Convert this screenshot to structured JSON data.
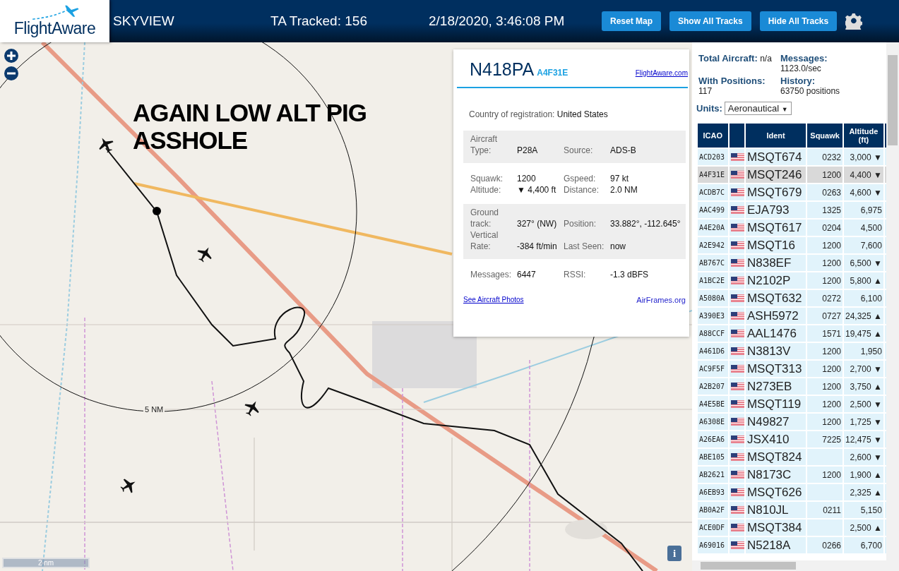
{
  "header": {
    "logo": "FlightAware",
    "title": "SKYVIEW",
    "tracked": "TA Tracked: 156",
    "datetime": "2/18/2020, 3:46:08 PM",
    "buttons": [
      "Reset Map",
      "Show All Tracks",
      "Hide All Tracks"
    ]
  },
  "map": {
    "annotation": "AGAIN LOW ALT PIG ASSHOLE",
    "ring_label": "5 NM",
    "scale": "2 nm",
    "info_button": "i"
  },
  "popup": {
    "ident": "N418PA",
    "hex": "A4F31E",
    "link": "FlightAware.com",
    "country_label": "Country of registration:",
    "country": "United States",
    "sections": [
      {
        "shaded": true,
        "rows": [
          [
            {
              "label": "Aircraft Type:",
              "value": "P28A"
            },
            {
              "label": "Source:",
              "value": "ADS-B"
            }
          ]
        ]
      },
      {
        "shaded": false,
        "rows": [
          [
            {
              "label": "Squawk:",
              "value": "1200"
            },
            {
              "label": "Gspeed:",
              "value": "97 kt"
            }
          ],
          [
            {
              "label": "Altitude:",
              "value": "▼ 4,400 ft"
            },
            {
              "label": "Distance:",
              "value": "2.0 NM"
            }
          ]
        ]
      },
      {
        "shaded": true,
        "rows": [
          [
            {
              "label": "Ground track:",
              "value": "327° (NW)"
            },
            {
              "label": "Position:",
              "value": "33.882°, -112.645°"
            }
          ],
          [
            {
              "label": "Vertical Rate:",
              "value": "-384 ft/min"
            },
            {
              "label": "Last Seen:",
              "value": "now"
            }
          ]
        ]
      },
      {
        "shaded": false,
        "rows": [
          [
            {
              "label": "Messages:",
              "value": "6447"
            },
            {
              "label": "RSSI:",
              "value": "-1.3 dBFS"
            }
          ]
        ]
      }
    ],
    "photos_link": "See Aircraft Photos",
    "airframes_link": "AirFrames.org"
  },
  "stats": [
    {
      "label": "Total Aircraft:",
      "value": "n/a"
    },
    {
      "label": "Messages:",
      "value": "1123.0/sec"
    },
    {
      "label": "With Positions:",
      "value": "117"
    },
    {
      "label": "History:",
      "value": "63750 positions"
    }
  ],
  "units": {
    "label": "Units:",
    "value": "Aeronautical",
    "arrow": "▼"
  },
  "table": {
    "columns": [
      "ICAO",
      "Ident",
      "Squawk",
      "Altitude (ft)"
    ],
    "rows": [
      {
        "icao": "ACD203",
        "ident": "MSQT674",
        "squawk": "0232",
        "altitude": "3,000 ▼",
        "selected": false
      },
      {
        "icao": "A4F31E",
        "ident": "MSQT246",
        "squawk": "1200",
        "altitude": "4,400 ▼",
        "selected": true
      },
      {
        "icao": "ACDB7C",
        "ident": "MSQT679",
        "squawk": "0263",
        "altitude": "4,600 ▼",
        "selected": false
      },
      {
        "icao": "AAC499",
        "ident": "EJA793",
        "squawk": "1325",
        "altitude": "6,975",
        "selected": false
      },
      {
        "icao": "A4E20A",
        "ident": "MSQT617",
        "squawk": "0204",
        "altitude": "4,500",
        "selected": false
      },
      {
        "icao": "A2E942",
        "ident": "MSQT16",
        "squawk": "1200",
        "altitude": "7,600",
        "selected": false
      },
      {
        "icao": "AB767C",
        "ident": "N838EF",
        "squawk": "1200",
        "altitude": "6,500 ▼",
        "selected": false
      },
      {
        "icao": "A1BC2E",
        "ident": "N2102P",
        "squawk": "1200",
        "altitude": "5,800 ▲",
        "selected": false
      },
      {
        "icao": "A5080A",
        "ident": "MSQT632",
        "squawk": "0272",
        "altitude": "6,100",
        "selected": false
      },
      {
        "icao": "A390E3",
        "ident": "ASH5972",
        "squawk": "0727",
        "altitude": "24,325 ▲",
        "selected": false
      },
      {
        "icao": "A88CCF",
        "ident": "AAL1476",
        "squawk": "1571",
        "altitude": "19,475 ▲",
        "selected": false
      },
      {
        "icao": "A461D6",
        "ident": "N3813V",
        "squawk": "1200",
        "altitude": "1,950",
        "selected": false
      },
      {
        "icao": "AC9F5F",
        "ident": "MSQT313",
        "squawk": "1200",
        "altitude": "2,700 ▼",
        "selected": false
      },
      {
        "icao": "A2B207",
        "ident": "N273EB",
        "squawk": "1200",
        "altitude": "3,750 ▲",
        "selected": false
      },
      {
        "icao": "A4E5BE",
        "ident": "MSQT119",
        "squawk": "1200",
        "altitude": "2,500 ▼",
        "selected": false
      },
      {
        "icao": "A6308E",
        "ident": "N49827",
        "squawk": "1200",
        "altitude": "1,725 ▼",
        "selected": false
      },
      {
        "icao": "A26EA6",
        "ident": "JSX410",
        "squawk": "7225",
        "altitude": "12,475 ▼",
        "selected": false
      },
      {
        "icao": "ABE105",
        "ident": "MSQT824",
        "altitude": "2,600 ▼",
        "selected": false
      },
      {
        "icao": "AB2621",
        "ident": "N8173C",
        "squawk": "1200",
        "altitude": "1,900 ▲",
        "selected": false
      },
      {
        "icao": "A6EB93",
        "ident": "MSQT626",
        "altitude": "2,325 ▲",
        "selected": false
      },
      {
        "icao": "AB0A2F",
        "ident": "N810JL",
        "squawk": "0211",
        "altitude": "5,150",
        "selected": false
      },
      {
        "icao": "ACE0DF",
        "ident": "MSQT384",
        "altitude": "2,500 ▲",
        "selected": false
      },
      {
        "icao": "A69016",
        "ident": "N5218A",
        "squawk": "0266",
        "altitude": "6,700",
        "selected": false
      }
    ]
  }
}
